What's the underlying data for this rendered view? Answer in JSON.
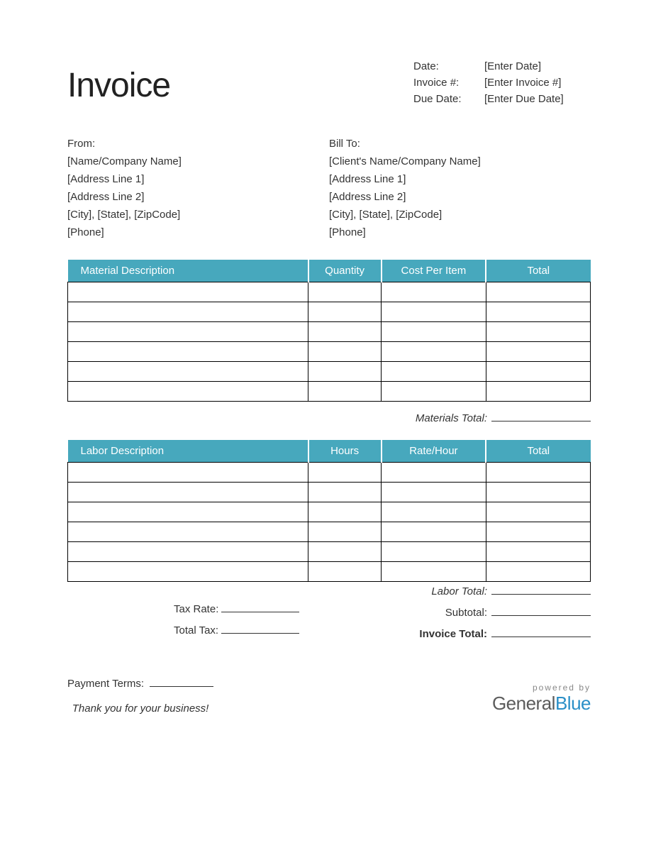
{
  "title": "Invoice",
  "meta": {
    "date_label": "Date:",
    "date_value": "[Enter Date]",
    "invoice_num_label": "Invoice #:",
    "invoice_num_value": "[Enter Invoice #]",
    "due_date_label": "Due Date:",
    "due_date_value": "[Enter Due Date]"
  },
  "from": {
    "heading": "From:",
    "name": "[Name/Company Name]",
    "addr1": "[Address Line 1]",
    "addr2": "[Address Line 2]",
    "city": "[City], [State], [ZipCode]",
    "phone": "[Phone]"
  },
  "bill_to": {
    "heading": "Bill To:",
    "name": "[Client's Name/Company Name]",
    "addr1": "[Address Line 1]",
    "addr2": "[Address Line 2]",
    "city": "[City], [State], [ZipCode]",
    "phone": "[Phone]"
  },
  "materials": {
    "headers": {
      "desc": "Material Description",
      "qty": "Quantity",
      "cost": "Cost Per Item",
      "total": "Total"
    },
    "rows": [
      {
        "desc": "",
        "qty": "",
        "cost": "",
        "total": ""
      },
      {
        "desc": "",
        "qty": "",
        "cost": "",
        "total": ""
      },
      {
        "desc": "",
        "qty": "",
        "cost": "",
        "total": ""
      },
      {
        "desc": "",
        "qty": "",
        "cost": "",
        "total": ""
      },
      {
        "desc": "",
        "qty": "",
        "cost": "",
        "total": ""
      },
      {
        "desc": "",
        "qty": "",
        "cost": "",
        "total": ""
      }
    ],
    "subtotal_label": "Materials Total:",
    "subtotal_value": ""
  },
  "labor": {
    "headers": {
      "desc": "Labor Description",
      "qty": "Hours",
      "cost": "Rate/Hour",
      "total": "Total"
    },
    "rows": [
      {
        "desc": "",
        "qty": "",
        "cost": "",
        "total": ""
      },
      {
        "desc": "",
        "qty": "",
        "cost": "",
        "total": ""
      },
      {
        "desc": "",
        "qty": "",
        "cost": "",
        "total": ""
      },
      {
        "desc": "",
        "qty": "",
        "cost": "",
        "total": ""
      },
      {
        "desc": "",
        "qty": "",
        "cost": "",
        "total": ""
      },
      {
        "desc": "",
        "qty": "",
        "cost": "",
        "total": ""
      }
    ],
    "subtotal_label": "Labor Total:",
    "subtotal_value": ""
  },
  "summary": {
    "tax_rate_label": "Tax Rate:",
    "tax_rate_value": "",
    "total_tax_label": "Total Tax:",
    "total_tax_value": "",
    "subtotal_label": "Subtotal:",
    "subtotal_value": "",
    "invoice_total_label": "Invoice Total:",
    "invoice_total_value": ""
  },
  "footer": {
    "payment_terms_label": "Payment Terms:",
    "payment_terms_value": "",
    "thanks": "Thank you for your business!",
    "powered": "powered by",
    "logo1": "General",
    "logo2": "Blue"
  }
}
